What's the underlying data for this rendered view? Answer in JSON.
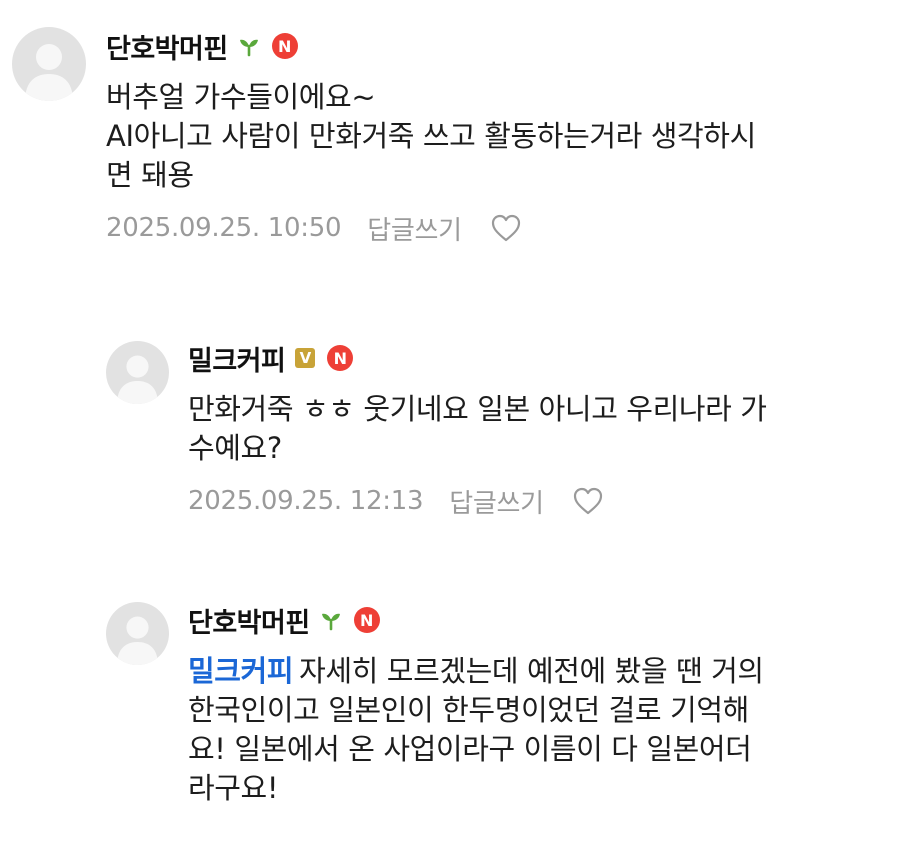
{
  "comments": [
    {
      "username": "단호박머핀",
      "grade_badge": "sprout-icon",
      "n_badge": "N",
      "lines": [
        "버추얼 가수들이에요~",
        "AI아니고 사람이 만화거죽 쓰고 활동하는거라 생각하시",
        "면 돼용"
      ],
      "date": "2025.09.25. 10:50",
      "reply_label": "답글쓰기"
    },
    {
      "username": "밀크커피",
      "grade_badge": "V",
      "n_badge": "N",
      "lines": [
        "만화거죽 ㅎㅎ 웃기네요 일본 아니고 우리나라 가",
        "수예요?"
      ],
      "date": "2025.09.25. 12:13",
      "reply_label": "답글쓰기"
    },
    {
      "username": "단호박머핀",
      "grade_badge": "sprout-icon",
      "n_badge": "N",
      "mention": "밀크커피",
      "lines": [
        "자세히 모르겠는데 예전에 봤을 땐 거의",
        "한국인이고 일본인이 한두명이었던 걸로 기억해",
        "요! 일본에서 온 사업이라구 이름이 다 일본어더",
        "라구요!"
      ]
    }
  ],
  "colors": {
    "mention": "#1b67d6",
    "n_badge": "#ee3f36",
    "v_badge": "#c8a338",
    "sprout": "#5aa83c",
    "meta_text": "#9a9a9a"
  }
}
